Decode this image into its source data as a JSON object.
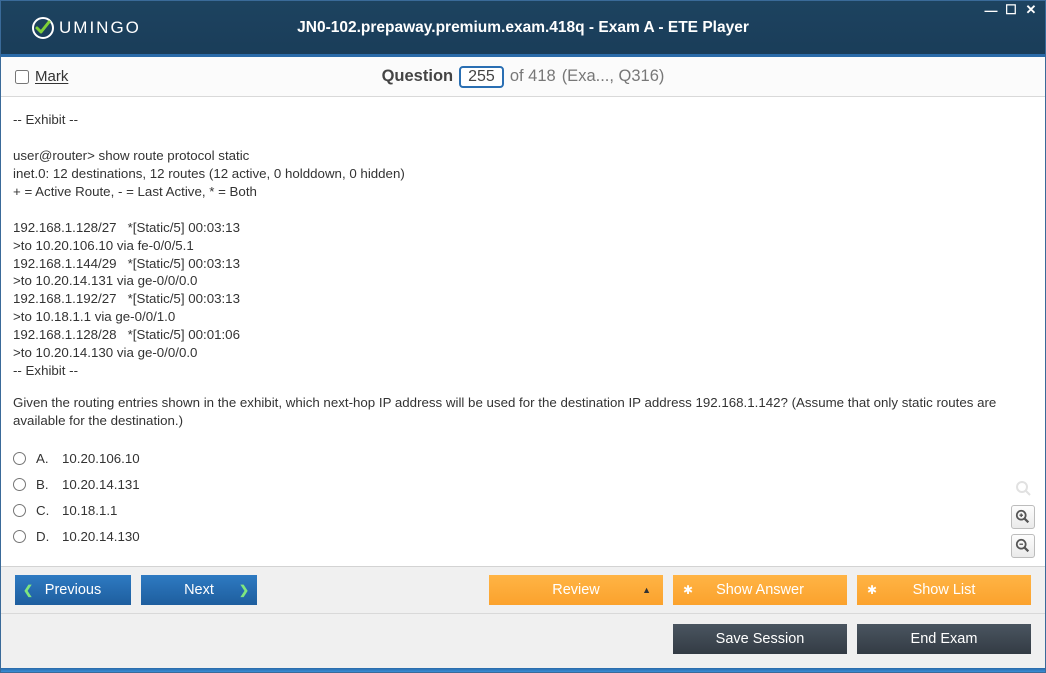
{
  "window": {
    "title": "JN0-102.prepaway.premium.exam.418q - Exam A - ETE Player",
    "brand": "UMINGO"
  },
  "info": {
    "mark_label": "Mark",
    "question_word": "Question",
    "current": "255",
    "total": "of 418",
    "meta": "(Exa..., Q316)"
  },
  "exhibit_lines": [
    "-- Exhibit --",
    "",
    "user@router> show route protocol static",
    "inet.0: 12 destinations, 12 routes (12 active, 0 holddown, 0 hidden)",
    "+ = Active Route, - = Last Active, * = Both",
    "",
    "192.168.1.128/27   *[Static/5] 00:03:13",
    ">to 10.20.106.10 via fe-0/0/5.1",
    "192.168.1.144/29   *[Static/5] 00:03:13",
    ">to 10.20.14.131 via ge-0/0/0.0",
    "192.168.1.192/27   *[Static/5] 00:03:13",
    ">to 10.18.1.1 via ge-0/0/1.0",
    "192.168.1.128/28   *[Static/5] 00:01:06",
    ">to 10.20.14.130 via ge-0/0/0.0",
    "-- Exhibit --"
  ],
  "question_text": "Given the routing entries shown in the exhibit, which next-hop IP address will be used for the destination IP address 192.168.1.142? (Assume that only static routes are available for the destination.)",
  "answers": [
    {
      "letter": "A.",
      "text": "10.20.106.10"
    },
    {
      "letter": "B.",
      "text": "10.20.14.131"
    },
    {
      "letter": "C.",
      "text": "10.18.1.1"
    },
    {
      "letter": "D.",
      "text": "10.20.14.130"
    }
  ],
  "buttons": {
    "previous": "Previous",
    "next": "Next",
    "review": "Review",
    "show_answer": "Show Answer",
    "show_list": "Show List",
    "save_session": "Save Session",
    "end_exam": "End Exam"
  }
}
